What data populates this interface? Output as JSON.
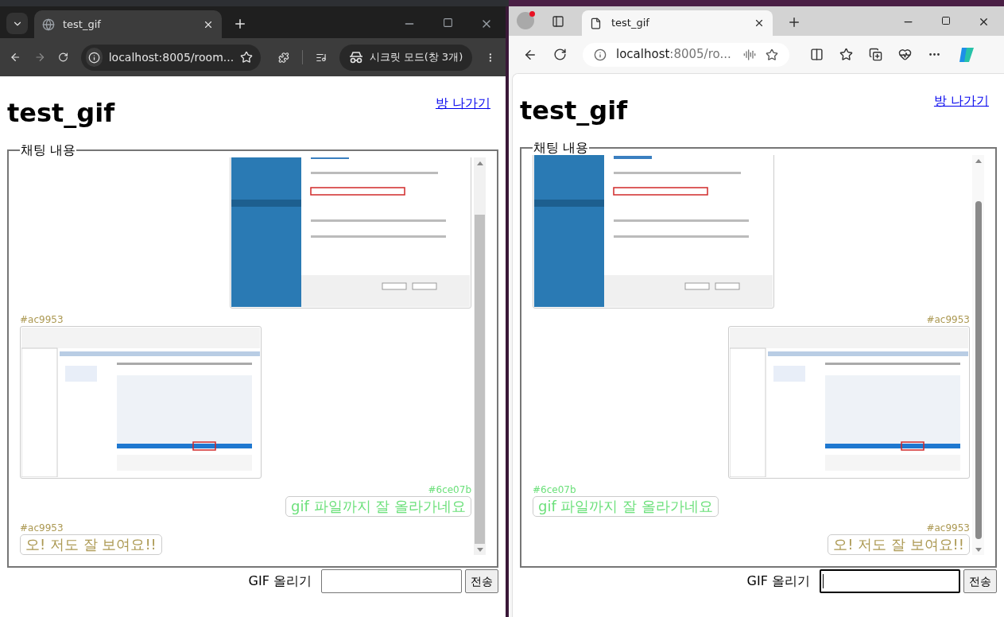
{
  "windows": [
    {
      "kind": "chrome",
      "tab_title": "test_gif",
      "address_host": "localhost",
      "address_path": ":8005/room...",
      "incognito_label": "시크릿 모드(창 3개)",
      "page": {
        "title": "test_gif",
        "leave_link": "방 나가기",
        "legend": "채팅 내용",
        "upload_label": "GIF 올리기",
        "send_button": "전송",
        "input_focused": false,
        "messages": [
          {
            "kind": "installer",
            "right_aligned": true
          },
          {
            "kind": "services",
            "right_aligned": false,
            "author": "#ac9953",
            "color": "#ac9953"
          },
          {
            "kind": "text",
            "right_aligned": true,
            "author": "#6ce07b",
            "color": "#6ce07b",
            "text": "gif 파일까지 잘 올라가네요"
          },
          {
            "kind": "text",
            "right_aligned": false,
            "author": "#ac9953",
            "color": "#ac9953",
            "text": "오! 저도 잘 보여요!!"
          }
        ]
      }
    },
    {
      "kind": "edge",
      "tab_title": "test_gif",
      "address_host": "localhost",
      "address_path": ":8005/ro...",
      "page": {
        "title": "test_gif",
        "leave_link": "방 나가기",
        "legend": "채팅 내용",
        "upload_label": "GIF 올리기",
        "send_button": "전송",
        "input_focused": true,
        "messages": [
          {
            "kind": "installer",
            "right_aligned": false
          },
          {
            "kind": "services",
            "right_aligned": true,
            "author": "#ac9953",
            "color": "#ac9953"
          },
          {
            "kind": "text",
            "right_aligned": false,
            "author": "#6ce07b",
            "color": "#6ce07b",
            "text": "gif 파일까지 잘 올라가네요"
          },
          {
            "kind": "text",
            "right_aligned": true,
            "author": "#ac9953",
            "color": "#ac9953",
            "text": "오! 저도 잘 보여요!!"
          }
        ]
      }
    }
  ]
}
